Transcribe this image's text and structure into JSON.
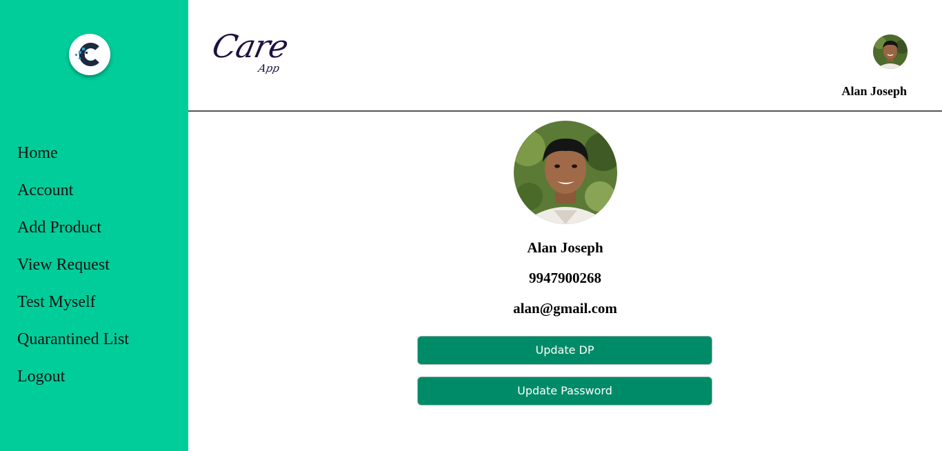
{
  "sidebar": {
    "logo_icon": "care-app-logo-icon",
    "items": [
      {
        "label": "Home"
      },
      {
        "label": "Account"
      },
      {
        "label": "Add Product"
      },
      {
        "label": "View Request"
      },
      {
        "label": "Test Myself"
      },
      {
        "label": "Quarantined List"
      },
      {
        "label": "Logout"
      }
    ]
  },
  "header": {
    "brand_main": "Care",
    "brand_sub": "App",
    "user_name": "Alan Joseph"
  },
  "profile": {
    "name": "Alan Joseph",
    "phone": "9947900268",
    "email": "alan@gmail.com",
    "update_dp_label": "Update DP",
    "update_password_label": "Update Password"
  },
  "colors": {
    "sidebar_bg": "#00cd9a",
    "button_bg": "#008b68",
    "brand_text": "#1f1140"
  }
}
